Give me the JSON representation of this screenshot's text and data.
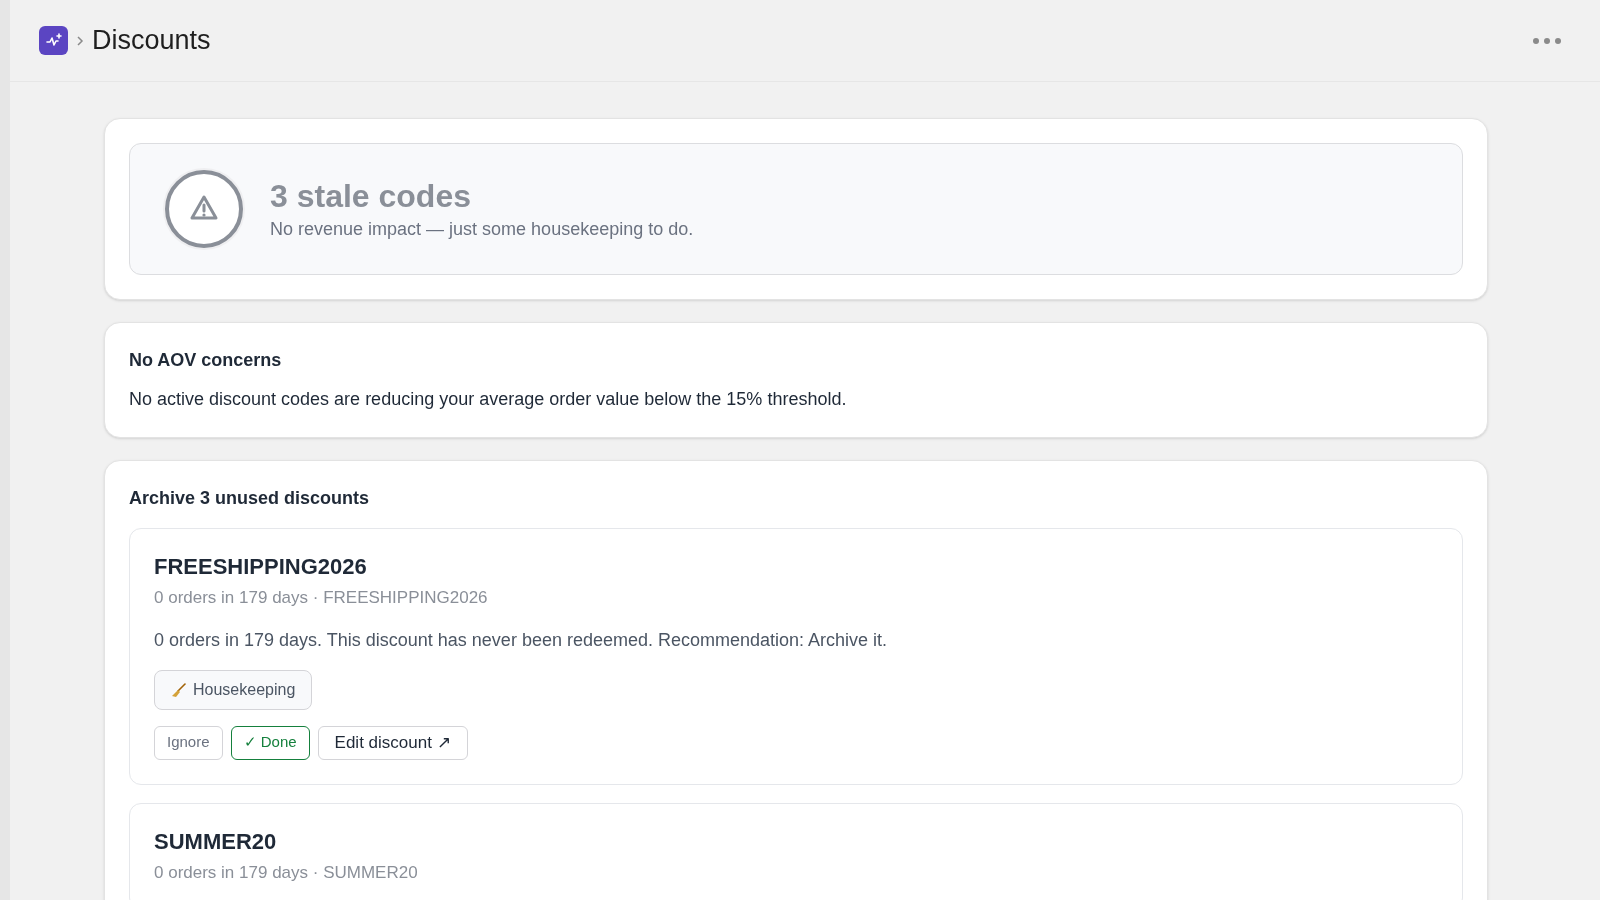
{
  "header": {
    "title": "Discounts"
  },
  "summary": {
    "title": "3 stale codes",
    "subtitle": "No revenue impact — just some housekeeping to do."
  },
  "aov": {
    "title": "No AOV concerns",
    "text": "No active discount codes are reducing your average order value below the 15% threshold."
  },
  "archive": {
    "title": "Archive 3 unused discounts",
    "discounts": [
      {
        "name": "FREESHIPPING2026",
        "meta": "0 orders in 179 days · FREESHIPPING2026",
        "description": "0 orders in 179 days. This discount has never been redeemed. Recommendation: Archive it.",
        "tag": "Housekeeping",
        "actions": [
          {
            "kind": "ignore",
            "label": "Ignore"
          },
          {
            "kind": "done",
            "label": "✓ Done"
          },
          {
            "kind": "edit",
            "label": "Edit discount ↗"
          }
        ]
      },
      {
        "name": "SUMMER20",
        "meta": "0 orders in 179 days · SUMMER20"
      }
    ]
  }
}
